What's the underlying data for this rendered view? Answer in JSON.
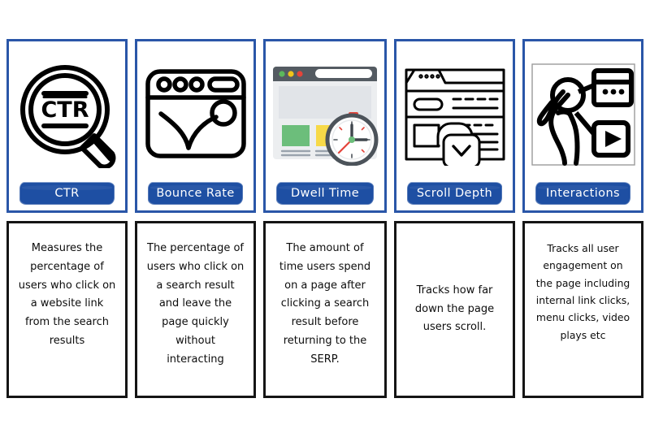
{
  "cards": [
    {
      "id": "ctr",
      "icon": "magnifier-ctr-icon",
      "label": "CTR",
      "description": "Measures the percentage of users who click on a website link from the search results"
    },
    {
      "id": "bounce-rate",
      "icon": "browser-bounce-icon",
      "label": "Bounce Rate",
      "description": "The percentage of users who click on a search result and leave the page quickly without interacting"
    },
    {
      "id": "dwell-time",
      "icon": "browser-stopwatch-icon",
      "label": "Dwell Time",
      "description": "The amount of time users spend on a page after clicking a search result before returning to the SERP."
    },
    {
      "id": "scroll-depth",
      "icon": "webpage-scroll-chevron-icon",
      "label": "Scroll Depth",
      "description": "Tracks how far down the page users scroll."
    },
    {
      "id": "interactions",
      "icon": "hand-tap-media-icon",
      "label": "Interactions",
      "description": "Tracks all user engagement on the page including internal link clicks, menu clicks, video plays etc"
    }
  ],
  "colors": {
    "card_border_blue": "#2a56a8",
    "banner_blue": "#1e4fa3",
    "desc_border_black": "#151515",
    "icon_line": "#000000",
    "dwell_green_block": "#6cbe7b",
    "dwell_yellow_block": "#f7d948",
    "dwell_titlebar": "#545b62",
    "dwell_body": "#eceef0",
    "stopwatch_red": "#e4443a"
  }
}
